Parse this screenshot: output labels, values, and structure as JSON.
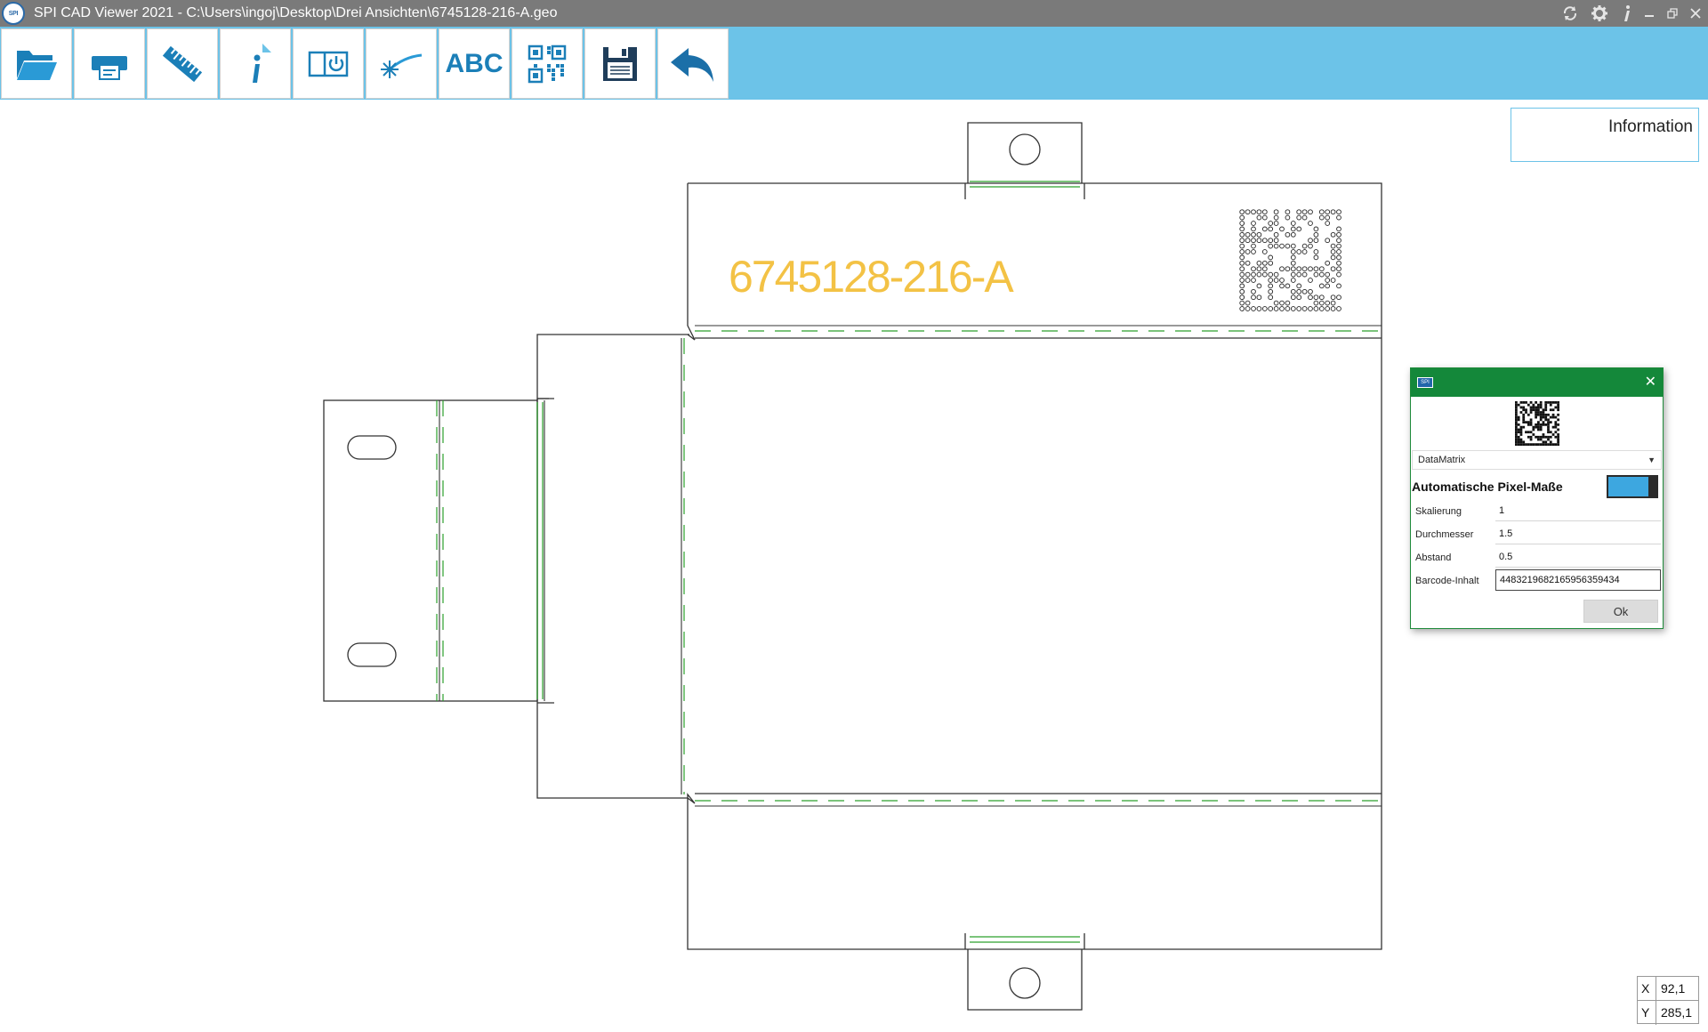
{
  "window": {
    "title": "SPI CAD Viewer 2021 - C:\\Users\\ingoj\\Desktop\\Drei Ansichten\\6745128-216-A.geo",
    "logo_text": "SPI",
    "controls": [
      "refresh-icon",
      "gear-icon",
      "info-icon",
      "minimize-icon",
      "restore-icon",
      "close-icon"
    ]
  },
  "toolbar": {
    "buttons": [
      {
        "icon": "folder-open-icon"
      },
      {
        "icon": "printer-icon"
      },
      {
        "icon": "ruler-icon"
      },
      {
        "icon": "document-info-icon"
      },
      {
        "icon": "power-panel-icon"
      },
      {
        "icon": "laser-icon"
      },
      {
        "icon": "text-icon",
        "label": "ABC"
      },
      {
        "icon": "qr-code-icon"
      },
      {
        "icon": "save-disk-icon"
      },
      {
        "icon": "undo-arrow-icon"
      }
    ],
    "accent_color": "#6cc3e8",
    "icon_color": "#1b7fb8"
  },
  "info_panel": {
    "label": "Information"
  },
  "drawing": {
    "part_label": "6745128-216-A",
    "label_color": "#f3c245",
    "crease_color": "#2ca02c"
  },
  "dialog": {
    "header_color": "#14883a",
    "barcode_type": "DataMatrix",
    "auto_pixel_label": "Automatische Pixel-Maße",
    "auto_pixel_enabled": true,
    "fields": [
      {
        "label": "Skalierung",
        "value": "1"
      },
      {
        "label": "Durchmesser",
        "value": "1.5"
      },
      {
        "label": "Abstand",
        "value": "0.5"
      },
      {
        "label": "Barcode-Inhalt",
        "value": "44832196821659563594​34"
      }
    ],
    "ok_label": "Ok"
  },
  "coords": {
    "x_label": "X",
    "x_value": "92,1",
    "y_label": "Y",
    "y_value": "285,1"
  }
}
